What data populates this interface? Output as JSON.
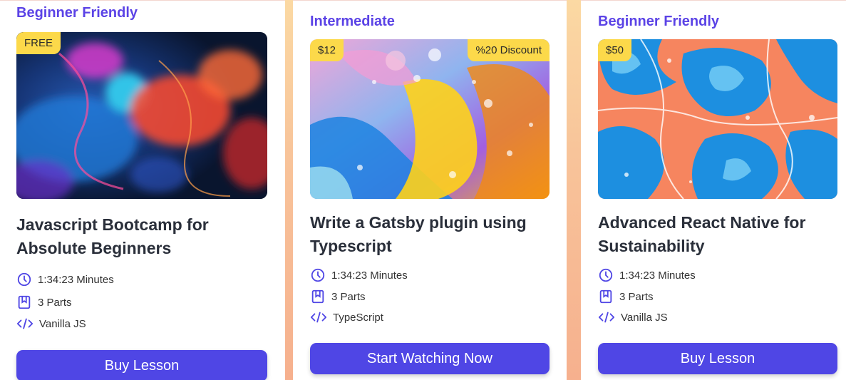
{
  "colors": {
    "accent": "#4f46e5",
    "level_text": "#5b43e6",
    "badge": "#fcd94a",
    "background_gradient": [
      "#fbd9a3",
      "#f6b08e"
    ]
  },
  "cards": [
    {
      "level": "Beginner Friendly",
      "price_badge": "FREE",
      "discount_badge": "",
      "title": "Javascript Bootcamp for Absolute Beginners",
      "duration": "1:34:23 Minutes",
      "parts": "3 Parts",
      "tech": "Vanilla JS",
      "button": "Buy Lesson",
      "image": "abstract-ink-smoke"
    },
    {
      "level": "Intermediate",
      "price_badge": "$12",
      "discount_badge": "%20 Discount",
      "title": "Write a Gatsby plugin using Typescript",
      "duration": "1:34:23 Minutes",
      "parts": "3 Parts",
      "tech": "TypeScript",
      "button": "Start Watching Now",
      "image": "colorful-bubbles"
    },
    {
      "level": "Beginner Friendly",
      "price_badge": "$50",
      "discount_badge": "",
      "title": "Advanced React Native for Sustainability",
      "duration": "1:34:23 Minutes",
      "parts": "3 Parts",
      "tech": "Vanilla JS",
      "button": "Buy Lesson",
      "image": "fluid-marble-art"
    }
  ],
  "icons": {
    "duration": "clock-icon",
    "parts": "bookmark-icon",
    "tech": "code-icon"
  }
}
